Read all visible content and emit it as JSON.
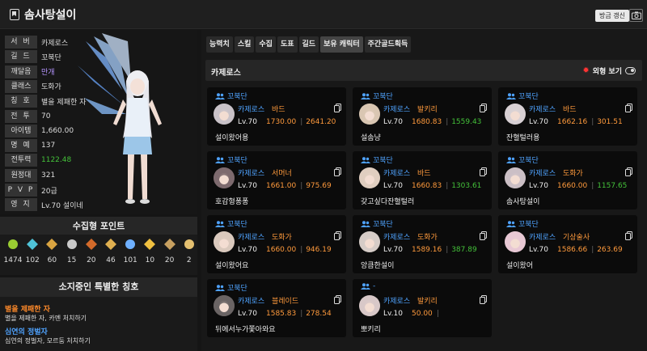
{
  "header": {
    "title": "솜사탕설이",
    "refresh_label": "방금 갱신"
  },
  "profile": {
    "rows": [
      {
        "key": "서 버",
        "value": "카제로스",
        "tone": ""
      },
      {
        "key": "길 드",
        "value": "꼬북단",
        "tone": ""
      },
      {
        "key": "깨달음",
        "value": "만개",
        "tone": "purple"
      },
      {
        "key": "클래스",
        "value": "도화가",
        "tone": ""
      },
      {
        "key": "칭 호",
        "value": "별을 제패한 자",
        "tone": ""
      },
      {
        "key": "전 투",
        "value": "70",
        "tone": ""
      },
      {
        "key": "아이템",
        "value": "1,660.00",
        "tone": ""
      },
      {
        "key": "명 예",
        "value": "137",
        "tone": ""
      },
      {
        "key": "전투력",
        "value": "1122.48",
        "tone": "green"
      },
      {
        "key": "원정대",
        "value": "321",
        "tone": ""
      },
      {
        "key": "P V P",
        "value": "20급",
        "tone": ""
      },
      {
        "key": "영 지",
        "value": "Lv.70 설이네",
        "tone": ""
      }
    ]
  },
  "collect": {
    "title": "수집형 포인트",
    "items": [
      {
        "icon": "mokoko-seed-icon",
        "value": "1474"
      },
      {
        "icon": "island-heart-icon",
        "value": "102"
      },
      {
        "icon": "great-art-icon",
        "value": "60"
      },
      {
        "icon": "giant-heart-icon",
        "value": "15"
      },
      {
        "icon": "ignea-token-icon",
        "value": "20"
      },
      {
        "icon": "adventure-tome-icon",
        "value": "46"
      },
      {
        "icon": "world-tree-leaf-icon",
        "value": "101"
      },
      {
        "icon": "orpheus-star-icon",
        "value": "10"
      },
      {
        "icon": "sea-bounty-icon",
        "value": "20"
      },
      {
        "icon": "orchestra-score-icon",
        "value": "2"
      }
    ]
  },
  "titles": {
    "title": "소지중인 특별한 칭호",
    "items": [
      {
        "name": "별을 제패한 자",
        "desc": "별을 제패한 자, 카멘 처치하기",
        "color": "#ff8a2a"
      },
      {
        "name": "심연의 정벌자",
        "desc": "심연의 정벌자, 모르둠 처치하기",
        "color": "#4fa3ff"
      }
    ]
  },
  "tabs": [
    "능력치",
    "스킬",
    "수집",
    "도표",
    "길드",
    "보유 캐릭터",
    "주간골드획득"
  ],
  "server": {
    "name": "카제로스",
    "view_label": "외형 보기"
  },
  "characters": [
    {
      "guild": "꼬북단",
      "server": "카제로스",
      "cls": "바드",
      "lv": "Lv.70",
      "il": "1730.00",
      "cp": "2641.20",
      "cp_color": "#ff9a3c",
      "name": "설이왔어용"
    },
    {
      "guild": "꼬북단",
      "server": "카제로스",
      "cls": "발키리",
      "lv": "Lv.70",
      "il": "1680.83",
      "cp": "1559.43",
      "cp_color": "#44c23a",
      "name": "설솜냥"
    },
    {
      "guild": "꼬북단",
      "server": "카제로스",
      "cls": "바드",
      "lv": "Lv.70",
      "il": "1662.16",
      "cp": "301.51",
      "cp_color": "#ff9a3c",
      "name": "잔혈털러용"
    },
    {
      "guild": "꼬북단",
      "server": "카제로스",
      "cls": "서머너",
      "lv": "Lv.70",
      "il": "1661.00",
      "cp": "975.69",
      "cp_color": "#ff9a3c",
      "name": "호감형퐁퐁"
    },
    {
      "guild": "꼬북단",
      "server": "카제로스",
      "cls": "바드",
      "lv": "Lv.70",
      "il": "1660.83",
      "cp": "1303.61",
      "cp_color": "#44c23a",
      "name": "갖고싶다잔혈털러"
    },
    {
      "guild": "꼬북단",
      "server": "카제로스",
      "cls": "도화가",
      "lv": "Lv.70",
      "il": "1660.00",
      "cp": "1157.65",
      "cp_color": "#44c23a",
      "name": "솜사탕설이"
    },
    {
      "guild": "꼬북단",
      "server": "카제로스",
      "cls": "도화가",
      "lv": "Lv.70",
      "il": "1660.00",
      "cp": "946.19",
      "cp_color": "#ff9a3c",
      "name": "설이왔어요"
    },
    {
      "guild": "꼬북단",
      "server": "카제로스",
      "cls": "도화가",
      "lv": "Lv.70",
      "il": "1589.16",
      "cp": "387.89",
      "cp_color": "#44c23a",
      "name": "앙큼한설이"
    },
    {
      "guild": "꼬북단",
      "server": "카제로스",
      "cls": "기상술사",
      "lv": "Lv.70",
      "il": "1586.66",
      "cp": "263.69",
      "cp_color": "#ff9a3c",
      "name": "설이왔어"
    },
    {
      "guild": "꼬북단",
      "server": "카제로스",
      "cls": "블레이드",
      "lv": "Lv.70",
      "il": "1585.83",
      "cp": "278.54",
      "cp_color": "#ff9a3c",
      "name": "뒤에서누가쫓아와요"
    },
    {
      "guild": "-",
      "server": "카제로스",
      "cls": "발키리",
      "lv": "Lv.10",
      "il": "50.00",
      "cp": "",
      "cp_color": "#ff9a3c",
      "name": "뽀키리"
    }
  ]
}
